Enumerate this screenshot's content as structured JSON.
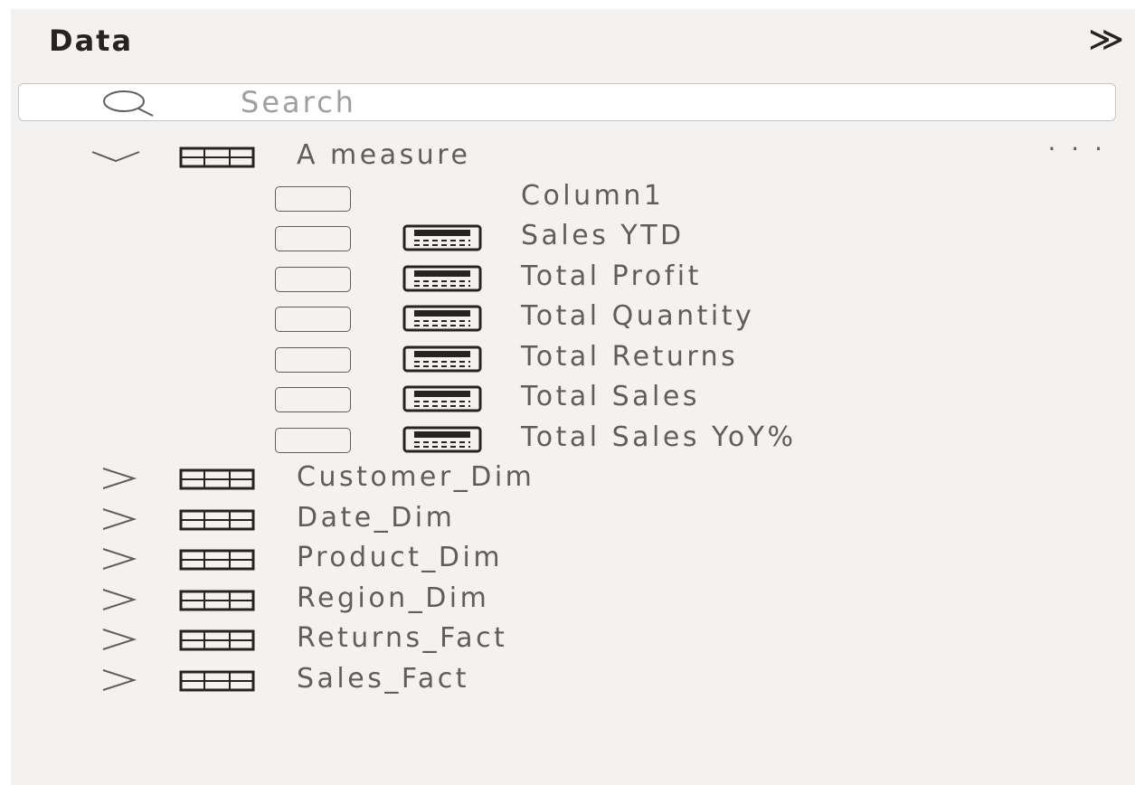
{
  "panel": {
    "title": "Data",
    "collapse_icon": "double-chevron-right-icon",
    "collapse_glyph": "≫"
  },
  "search": {
    "placeholder": "Search",
    "value": ""
  },
  "tables": [
    {
      "name": "A measure",
      "expanded": true,
      "more_glyph": "· · ·",
      "fields": [
        {
          "name": "Column1",
          "type": "column"
        },
        {
          "name": "Sales YTD",
          "type": "measure"
        },
        {
          "name": "Total Profit",
          "type": "measure"
        },
        {
          "name": "Total Quantity",
          "type": "measure"
        },
        {
          "name": "Total Returns",
          "type": "measure"
        },
        {
          "name": "Total Sales",
          "type": "measure"
        },
        {
          "name": "Total Sales YoY%",
          "type": "measure"
        }
      ]
    },
    {
      "name": "Customer_Dim",
      "expanded": false
    },
    {
      "name": "Date_Dim",
      "expanded": false
    },
    {
      "name": "Product_Dim",
      "expanded": false
    },
    {
      "name": "Region_Dim",
      "expanded": false
    },
    {
      "name": "Returns_Fact",
      "expanded": false
    },
    {
      "name": "Sales_Fact",
      "expanded": false
    }
  ],
  "colors": {
    "pane_bg": "#f3f2f1",
    "text_primary": "#252423",
    "text_secondary": "#605e5c"
  }
}
